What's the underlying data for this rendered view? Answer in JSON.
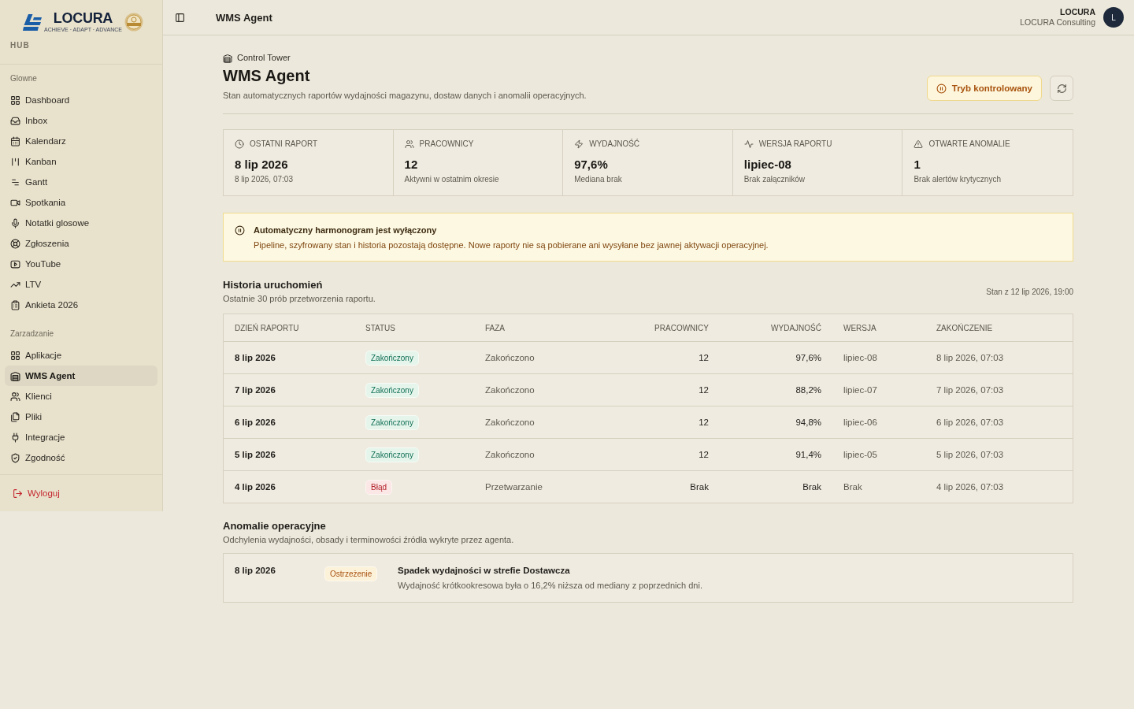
{
  "sidebar": {
    "logo": {
      "wordmark": "LOCURA",
      "tagline": "ACHIEVE · ADAPT · ADVANCE"
    },
    "hub_label": "HUB",
    "sections": [
      {
        "title": "Glowne",
        "items": [
          {
            "label": "Dashboard",
            "selected": false
          },
          {
            "label": "Inbox",
            "selected": false
          },
          {
            "label": "Kalendarz",
            "selected": false
          },
          {
            "label": "Kanban",
            "selected": false
          },
          {
            "label": "Gantt",
            "selected": false
          },
          {
            "label": "Spotkania",
            "selected": false
          },
          {
            "label": "Notatki glosowe",
            "selected": false
          },
          {
            "label": "Zgłoszenia",
            "selected": false
          },
          {
            "label": "YouTube",
            "selected": false
          },
          {
            "label": "LTV",
            "selected": false
          },
          {
            "label": "Ankieta 2026",
            "selected": false
          }
        ]
      },
      {
        "title": "Zarzadzanie",
        "items": [
          {
            "label": "Aplikacje",
            "selected": false
          },
          {
            "label": "WMS Agent",
            "selected": true
          },
          {
            "label": "Klienci",
            "selected": false
          },
          {
            "label": "Pliki",
            "selected": false
          },
          {
            "label": "Integracje",
            "selected": false
          },
          {
            "label": "Zgodność",
            "selected": false
          }
        ]
      }
    ],
    "logout": "Wyloguj"
  },
  "topbar": {
    "title": "WMS Agent",
    "user": {
      "name": "LOCURA",
      "organization": "LOCURA Consulting",
      "initial": "L"
    }
  },
  "page_header": {
    "breadcrumb": "Control Tower",
    "title": "WMS Agent",
    "subtitle": "Stan automatycznych raportów wydajności magazynu, dostaw danych i anomalii operacyjnych.",
    "mode_button": "Tryb kontrolowany"
  },
  "stats": [
    {
      "label": "OSTATNI RAPORT",
      "value": "8 lip 2026",
      "note": "8 lip 2026, 07:03"
    },
    {
      "label": "PRACOWNICY",
      "value": "12",
      "note": "Aktywni w ostatnim okresie"
    },
    {
      "label": "WYDAJNOŚĆ",
      "value": "97,6%",
      "note": "Mediana brak"
    },
    {
      "label": "WERSJA RAPORTU",
      "value": "lipiec-08",
      "note": "Brak załączników"
    },
    {
      "label": "OTWARTE ANOMALIE",
      "value": "1",
      "note": "Brak alertów krytycznych"
    }
  ],
  "notice": {
    "title": "Automatyczny harmonogram jest wyłączony",
    "text": "Pipeline, szyfrowany stan i historia pozostają dostępne. Nowe raporty nie są pobierane ani wysyłane bez jawnej aktywacji operacyjnej."
  },
  "history": {
    "title": "Historia uruchomień",
    "subtitle": "Ostatnie 30 prób przetworzenia raportu.",
    "as_of": "Stan z 12 lip 2026, 19:00",
    "columns": [
      "DZIEŃ RAPORTU",
      "STATUS",
      "FAZA",
      "PRACOWNICY",
      "WYDAJNOŚĆ",
      "WERSJA",
      "ZAKOŃCZENIE"
    ],
    "rows": [
      {
        "day": "8 lip 2026",
        "status": {
          "label": "Zakończony",
          "kind": "success"
        },
        "phase": "Zakończono",
        "workers": "12",
        "efficiency": "97,6%",
        "version": "lipiec-08",
        "finished": "8 lip 2026, 07:03"
      },
      {
        "day": "7 lip 2026",
        "status": {
          "label": "Zakończony",
          "kind": "success"
        },
        "phase": "Zakończono",
        "workers": "12",
        "efficiency": "88,2%",
        "version": "lipiec-07",
        "finished": "7 lip 2026, 07:03"
      },
      {
        "day": "6 lip 2026",
        "status": {
          "label": "Zakończony",
          "kind": "success"
        },
        "phase": "Zakończono",
        "workers": "12",
        "efficiency": "94,8%",
        "version": "lipiec-06",
        "finished": "6 lip 2026, 07:03"
      },
      {
        "day": "5 lip 2026",
        "status": {
          "label": "Zakończony",
          "kind": "success"
        },
        "phase": "Zakończono",
        "workers": "12",
        "efficiency": "91,4%",
        "version": "lipiec-05",
        "finished": "5 lip 2026, 07:03"
      },
      {
        "day": "4 lip 2026",
        "status": {
          "label": "Błąd",
          "kind": "error"
        },
        "phase": "Przetwarzanie",
        "workers": "Brak",
        "efficiency": "Brak",
        "version": "Brak",
        "finished": "4 lip 2026, 07:03"
      }
    ]
  },
  "anomalies": {
    "title": "Anomalie operacyjne",
    "subtitle": "Odchylenia wydajności, obsady i terminowości źródła wykryte przez agenta.",
    "items": [
      {
        "date": "8 lip 2026",
        "severity": {
          "label": "Ostrzeżenie",
          "kind": "warning"
        },
        "title": "Spadek wydajności w strefie Dostawcza",
        "text": "Wydajność krótkookresowa była o 16,2% niższa od mediany z poprzednich dni."
      }
    ]
  }
}
